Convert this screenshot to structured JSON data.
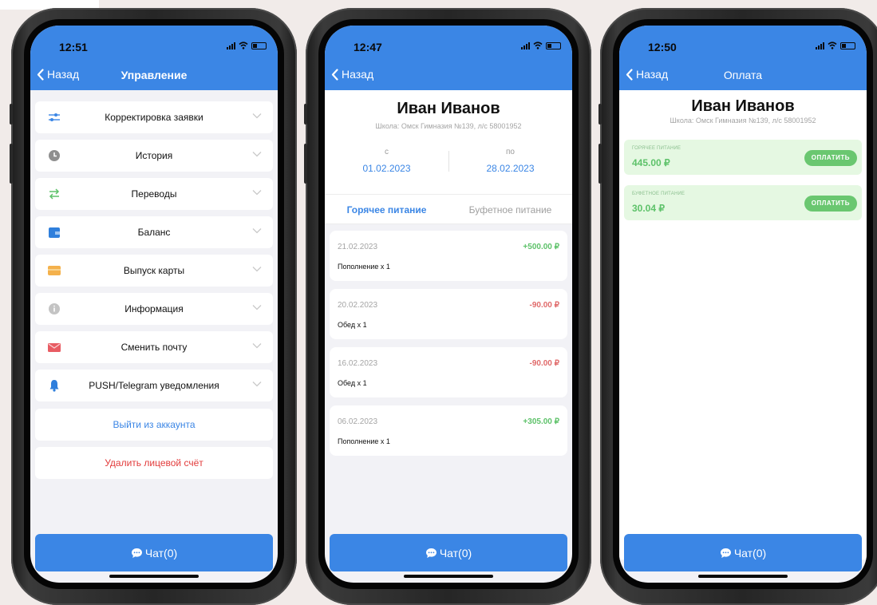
{
  "phone1": {
    "time": "12:51",
    "back_label": "Назад",
    "title": "Управление",
    "menu_items": [
      {
        "label": "Корректировка заявки",
        "icon": "sliders-icon"
      },
      {
        "label": "История",
        "icon": "clock-icon"
      },
      {
        "label": "Переводы",
        "icon": "transfer-arrows-icon"
      },
      {
        "label": "Баланс",
        "icon": "wallet-icon"
      },
      {
        "label": "Выпуск карты",
        "icon": "card-icon"
      },
      {
        "label": "Информация",
        "icon": "info-icon"
      },
      {
        "label": "Сменить почту",
        "icon": "mail-icon"
      },
      {
        "label": "PUSH/Telegram уведомления",
        "icon": "bell-icon"
      }
    ],
    "logout_label": "Выйти из аккаунта",
    "delete_label": "Удалить лицевой счёт",
    "chat_label": "Чат(0)"
  },
  "phone2": {
    "time": "12:47",
    "back_label": "Назад",
    "name": "Иван Иванов",
    "school": "Школа: Омск Гимназия №139, л/с 58001952",
    "from_label": "с",
    "from_date": "01.02.2023",
    "to_label": "по",
    "to_date": "28.02.2023",
    "tab_hot": "Горячее питание",
    "tab_buffet": "Буфетное питание",
    "transactions": [
      {
        "date": "21.02.2023",
        "amount": "+500.00 ₽",
        "desc": "Пополнение  x 1",
        "type": "pos"
      },
      {
        "date": "20.02.2023",
        "amount": "-90.00 ₽",
        "desc": "Обед x 1",
        "type": "neg"
      },
      {
        "date": "16.02.2023",
        "amount": "-90.00 ₽",
        "desc": "Обед x 1",
        "type": "neg"
      },
      {
        "date": "06.02.2023",
        "amount": "+305.00 ₽",
        "desc": "Пополнение  x 1",
        "type": "pos"
      }
    ],
    "chat_label": "Чат(0)"
  },
  "phone3": {
    "time": "12:50",
    "back_label": "Назад",
    "title": "Оплата",
    "name": "Иван Иванов",
    "school": "Школа: Омск Гимназия №139, л/с 58001952",
    "payments": [
      {
        "label": "ГОРЯЧЕЕ ПИТАНИЕ",
        "amount": "445.00 ₽",
        "button": "ОПЛАТИТЬ"
      },
      {
        "label": "БУФЕТНОЕ ПИТАНИЕ",
        "amount": "30.04 ₽",
        "button": "ОПЛАТИТЬ"
      }
    ],
    "chat_label": "Чат(0)"
  },
  "colors": {
    "primary": "#3b86e5",
    "positive": "#5ec26a",
    "negative": "#e06a6a",
    "danger": "#e23b3b",
    "pay_card_bg": "#e5f8e2"
  }
}
